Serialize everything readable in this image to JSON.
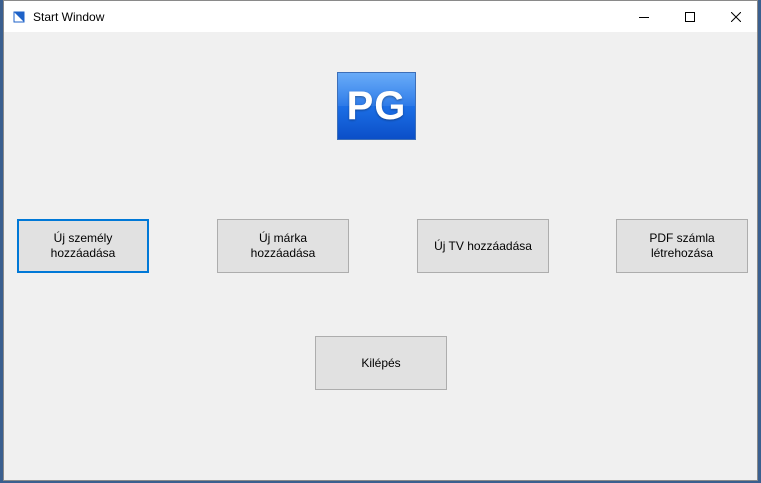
{
  "window": {
    "title": "Start Window",
    "icon": "app-form-icon",
    "controls": {
      "minimize_icon": "minimize-icon",
      "maximize_icon": "maximize-icon",
      "close_icon": "close-icon"
    }
  },
  "logo": {
    "text": "PG",
    "colors": {
      "top": "#2f8bf5",
      "bottom": "#0b4fc8"
    }
  },
  "buttons": {
    "new_person": "Új személy\nhozzáadása",
    "new_brand": "Új márka\nhozzáadása",
    "new_tv": "Új TV hozzáadása",
    "pdf_invoice": "PDF számla\nlétrehozása",
    "exit": "Kilépés"
  },
  "colors": {
    "window_bg": "#f0f0f0",
    "button_bg": "#e1e1e1",
    "focus_border": "#0078d7"
  }
}
